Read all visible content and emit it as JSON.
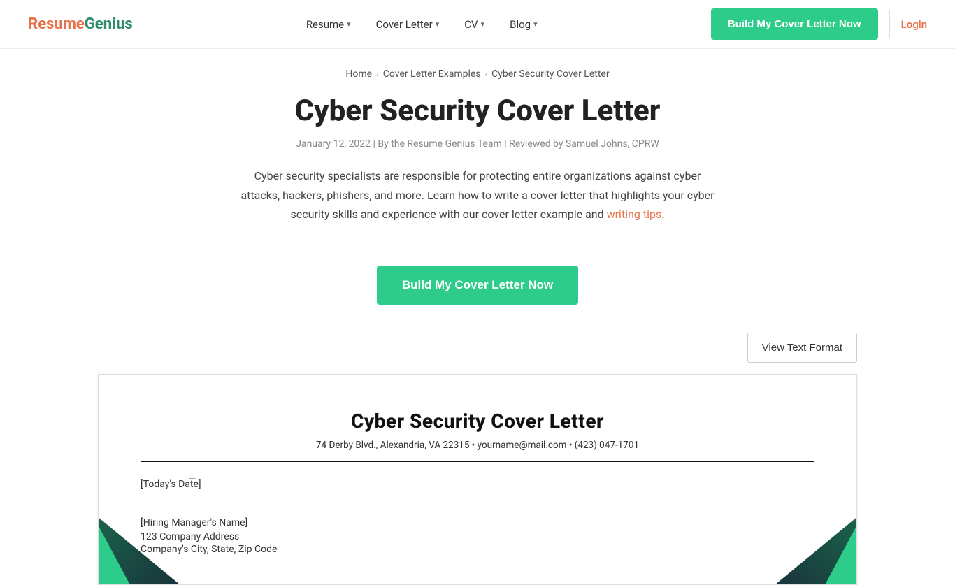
{
  "logo": {
    "resume_part": "Resume",
    "genius_part": "Genius"
  },
  "nav": {
    "items": [
      {
        "label": "Resume",
        "has_chevron": true
      },
      {
        "label": "Cover Letter",
        "has_chevron": true
      },
      {
        "label": "CV",
        "has_chevron": true
      },
      {
        "label": "Blog",
        "has_chevron": true
      }
    ],
    "build_button": "Build My Cover Letter Now",
    "login": "Login"
  },
  "breadcrumb": {
    "home": "Home",
    "examples": "Cover Letter Examples",
    "current": "Cyber Security Cover Letter"
  },
  "article": {
    "title": "Cyber Security Cover Letter",
    "meta": "January 12, 2022  |  By the Resume Genius Team  |  Reviewed by Samuel Johns, CPRW",
    "description_before_link": "Cyber security specialists are responsible for protecting entire organizations against cyber attacks, hackers, phishers, and more. Learn how to write a cover letter that highlights your cyber security skills and experience with our cover letter example and ",
    "writing_tips_link": "writing tips",
    "description_after_link": ".",
    "cta_button": "Build My Cover Letter Now"
  },
  "preview": {
    "view_text_format_btn": "View Text Format",
    "doc": {
      "title": "Cyber Security Cover Letter",
      "contact": "74 Derby Blvd., Alexandria, VA 22315  •  yourname@mail.com  •  (423) 047-1701",
      "date_field": "[Today's Date]",
      "hiring_manager": "[Hiring Manager's Name]",
      "company_address": "123 Company Address",
      "company_city": "Company's City, State, Zip Code"
    }
  }
}
